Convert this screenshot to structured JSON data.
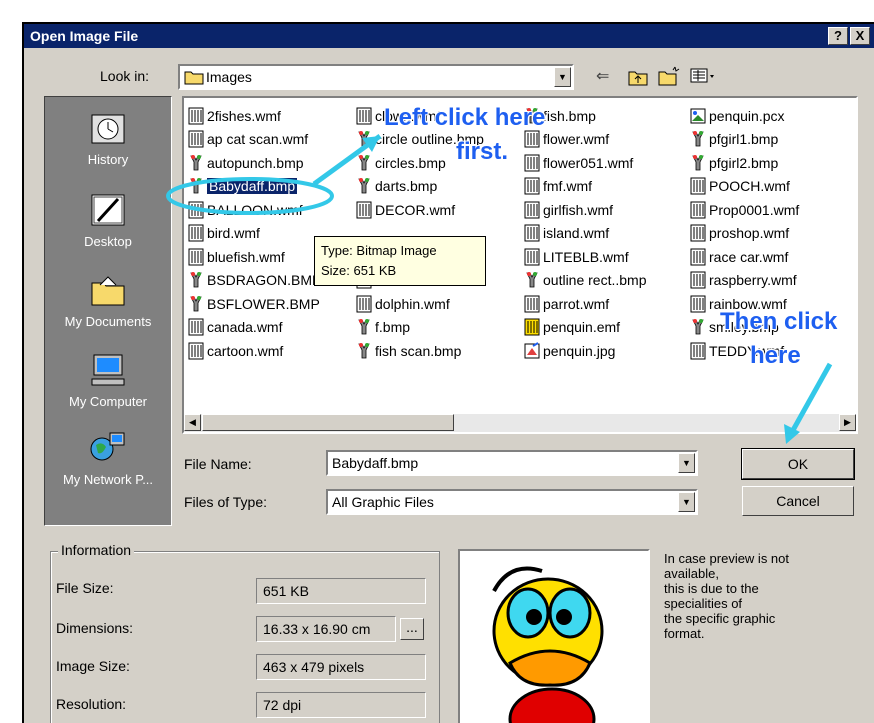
{
  "window": {
    "title": "Open Image File",
    "help_button": "?",
    "close_button": "X"
  },
  "look_in": {
    "label": "Look in:",
    "value": "Images"
  },
  "sidebar": {
    "items": [
      {
        "label": "History",
        "icon": "history-icon"
      },
      {
        "label": "Desktop",
        "icon": "desktop-icon"
      },
      {
        "label": "My Documents",
        "icon": "my-documents-icon"
      },
      {
        "label": "My Computer",
        "icon": "my-computer-icon"
      },
      {
        "label": "My Network P...",
        "icon": "network-places-icon"
      }
    ]
  },
  "files": {
    "columns": [
      [
        "2fishes.wmf",
        "ap cat scan.wmf",
        "autopunch.bmp",
        "Babydaff.bmp",
        "BALLOON.wmf",
        "bird.wmf",
        "bluefish.wmf",
        "BSDRAGON.BMP",
        "BSFLOWER.BMP",
        "canada.wmf",
        "cartoon.wmf"
      ],
      [
        "clown.wmf",
        "circle outline.bmp",
        "circles.bmp",
        "darts.bmp",
        "DECOR.wmf",
        "",
        "",
        "doll.wmf",
        "dolphin.wmf",
        "f.bmp",
        "fish scan.bmp"
      ],
      [
        "fish.bmp",
        "flower.wmf",
        "flower051.wmf",
        "fmf.wmf",
        "girlfish.wmf",
        "island.wmf",
        "LITEBLB.wmf",
        "outline rect..bmp",
        "parrot.wmf",
        "penquin.emf",
        "penquin.jpg"
      ],
      [
        "penquin.pcx",
        "pfgirl1.bmp",
        "pfgirl2.bmp",
        "POOCH.wmf",
        "Prop0001.wmf",
        "proshop.wmf",
        "race car.wmf",
        "raspberry.wmf",
        "rainbow.wmf",
        "smiley.bmp",
        "TEDDY.wmf"
      ]
    ],
    "selected": "Babydaff.bmp"
  },
  "tooltip": {
    "type": "Type: Bitmap Image",
    "size": "Size: 651 KB"
  },
  "file_name": {
    "label": "File Name:",
    "value": "Babydaff.bmp"
  },
  "files_of_type": {
    "label": "Files of Type:",
    "value": "All Graphic Files"
  },
  "buttons": {
    "ok": "OK",
    "cancel": "Cancel"
  },
  "information": {
    "heading": "Information",
    "file_size": {
      "label": "File Size:",
      "value": "651 KB"
    },
    "dimensions": {
      "label": "Dimensions:",
      "value": "16.33 x 16.90 cm",
      "more": "..."
    },
    "image_size": {
      "label": "Image Size:",
      "value": "463 x 479 pixels"
    },
    "resolution": {
      "label": "Resolution:",
      "value": "72 dpi"
    }
  },
  "preview_note": [
    "In case preview is not",
    "available,",
    "this is due to the",
    "specialities of",
    "the specific graphic",
    "format."
  ],
  "annotations": {
    "left_click_1": "Left click here",
    "left_click_2": "first.",
    "then_click_1": "Then click",
    "then_click_2": "here"
  },
  "colors": {
    "titlebar": "#0a246a",
    "dialog": "#d4d0c8",
    "annotation": "#1e5ff0",
    "arrow": "#33c8e8"
  }
}
